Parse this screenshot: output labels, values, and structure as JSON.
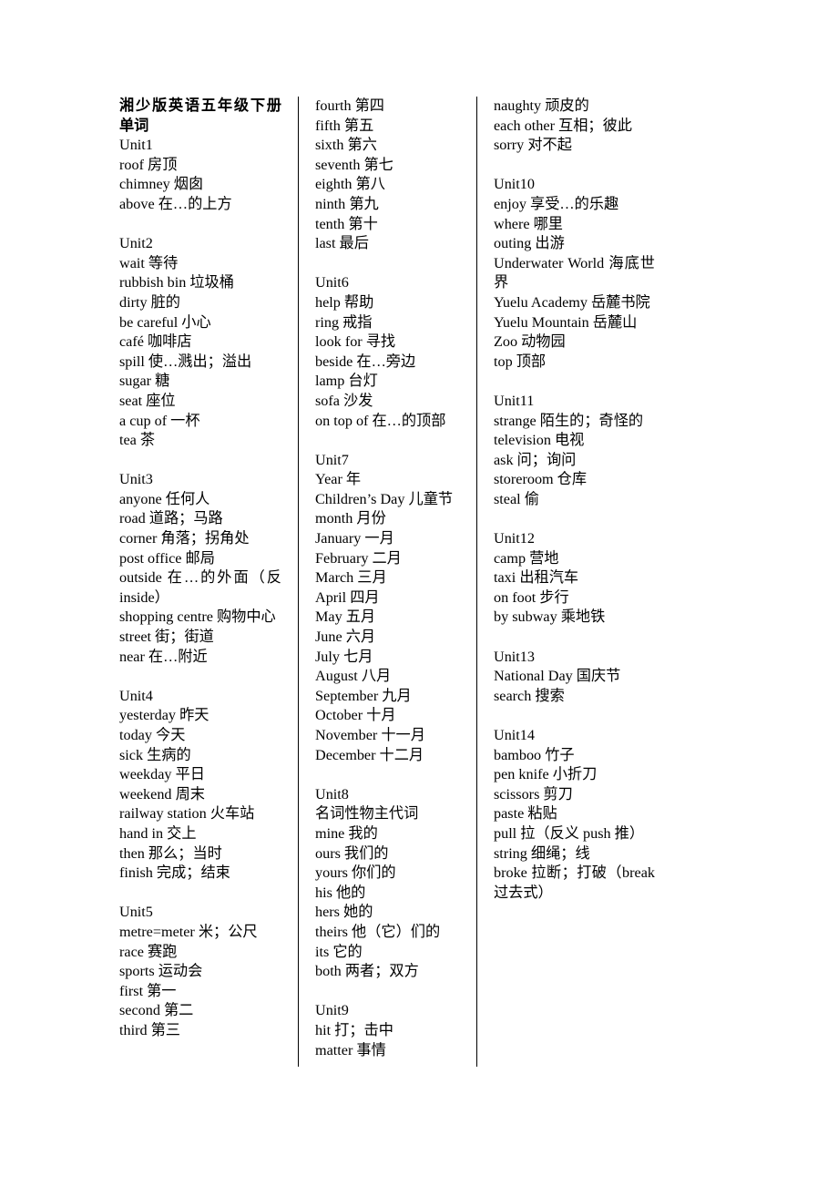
{
  "document": {
    "title": "湘少版英语五年级下册单词",
    "columns": [
      {
        "id": "column-1",
        "blocks": [
          {
            "type": "title",
            "lines": [
              "湘少版英语五年级下册单词"
            ]
          },
          {
            "type": "heading",
            "lines": [
              "Unit1"
            ]
          },
          {
            "type": "entries",
            "lines": [
              "roof 房顶",
              "chimney 烟囱",
              "above 在…的上方"
            ]
          },
          {
            "type": "spacer"
          },
          {
            "type": "heading",
            "lines": [
              "Unit2"
            ]
          },
          {
            "type": "entries",
            "lines": [
              "wait 等待",
              "rubbish bin 垃圾桶",
              "dirty 脏的",
              "be careful  小心",
              "café 咖啡店",
              "spill 使…溅出；溢出",
              "sugar 糖",
              "seat 座位",
              "a cup of 一杯",
              "tea 茶"
            ]
          },
          {
            "type": "spacer"
          },
          {
            "type": "heading",
            "lines": [
              "Unit3"
            ]
          },
          {
            "type": "entries",
            "lines": [
              "anyone 任何人",
              "road 道路；马路",
              "corner 角落；拐角处",
              "post office 邮局",
              "outside 在…的外面（反 inside）",
              "shopping centre 购物中心",
              "street 街；街道",
              "near 在…附近"
            ]
          },
          {
            "type": "spacer"
          },
          {
            "type": "heading",
            "lines": [
              "Unit4"
            ]
          },
          {
            "type": "entries",
            "lines": [
              "yesterday 昨天",
              "today 今天",
              "sick 生病的",
              "weekday 平日",
              "weekend 周末",
              "railway station 火车站",
              "hand in 交上",
              "then 那么；当时",
              "finish 完成；结束"
            ]
          },
          {
            "type": "spacer"
          },
          {
            "type": "heading",
            "lines": [
              "Unit5"
            ]
          },
          {
            "type": "entries",
            "lines": [
              "metre=meter 米；公尺",
              "race 赛跑",
              "sports 运动会",
              "first 第一",
              "second 第二",
              "third 第三"
            ]
          }
        ]
      },
      {
        "id": "column-2",
        "blocks": [
          {
            "type": "entries",
            "lines": [
              "fourth 第四",
              "fifth 第五",
              "sixth 第六",
              "seventh 第七",
              "eighth 第八",
              "ninth 第九",
              "tenth 第十",
              "last 最后"
            ]
          },
          {
            "type": "spacer"
          },
          {
            "type": "heading",
            "lines": [
              "Unit6"
            ]
          },
          {
            "type": "entries",
            "lines": [
              "help 帮助",
              "ring 戒指",
              "look for 寻找",
              "beside 在…旁边",
              "lamp 台灯",
              "sofa 沙发",
              "on top of 在…的顶部"
            ]
          },
          {
            "type": "spacer"
          },
          {
            "type": "heading",
            "lines": [
              "Unit7"
            ]
          },
          {
            "type": "entries",
            "lines": [
              "Year 年",
              "Children’s Day 儿童节",
              "month 月份",
              "January 一月",
              "February 二月",
              "March 三月",
              "April 四月",
              "May 五月",
              "June 六月",
              "July 七月",
              "August 八月",
              "September  九月",
              "October 十月",
              "November 十一月",
              "December 十二月"
            ]
          },
          {
            "type": "spacer"
          },
          {
            "type": "heading",
            "lines": [
              "Unit8"
            ]
          },
          {
            "type": "entries",
            "lines": [
              "名词性物主代词",
              "mine 我的",
              "ours 我们的",
              "yours 你们的",
              "his 他的",
              "hers 她的",
              "theirs 他（它）们的",
              "its  它的",
              "both 两者；双方"
            ]
          },
          {
            "type": "spacer"
          },
          {
            "type": "heading",
            "lines": [
              "Unit9"
            ]
          },
          {
            "type": "entries",
            "lines": [
              "hit 打；击中",
              "matter 事情"
            ]
          }
        ]
      },
      {
        "id": "column-3",
        "blocks": [
          {
            "type": "entries",
            "lines": [
              "naughty 顽皮的",
              "each other 互相；彼此",
              "sorry 对不起"
            ]
          },
          {
            "type": "spacer"
          },
          {
            "type": "heading",
            "lines": [
              "Unit10"
            ]
          },
          {
            "type": "entries",
            "lines": [
              "enjoy 享受…的乐趣",
              "where 哪里",
              "outing 出游",
              "Underwater World 海底世界",
              "Yuelu Academy 岳麓书院",
              "Yuelu Mountain 岳麓山",
              "Zoo 动物园",
              "top 顶部"
            ]
          },
          {
            "type": "spacer"
          },
          {
            "type": "heading",
            "lines": [
              "Unit11"
            ]
          },
          {
            "type": "entries",
            "lines": [
              "strange 陌生的；奇怪的",
              "television 电视",
              "ask 问；询问",
              "storeroom 仓库",
              "steal 偷"
            ]
          },
          {
            "type": "spacer"
          },
          {
            "type": "heading",
            "lines": [
              "Unit12"
            ]
          },
          {
            "type": "entries",
            "lines": [
              "camp 营地",
              "taxi 出租汽车",
              "on foot 步行",
              "by subway 乘地铁"
            ]
          },
          {
            "type": "spacer"
          },
          {
            "type": "heading",
            "lines": [
              "Unit13"
            ]
          },
          {
            "type": "entries",
            "lines": [
              "National Day 国庆节",
              "search 搜索"
            ]
          },
          {
            "type": "spacer"
          },
          {
            "type": "heading",
            "lines": [
              "Unit14"
            ]
          },
          {
            "type": "entries",
            "lines": [
              "bamboo 竹子",
              "pen knife 小折刀",
              "scissors 剪刀",
              "paste 粘贴",
              "pull 拉（反义 push 推）",
              "string 细绳；线",
              "broke 拉断；打破（break 过去式）"
            ]
          }
        ]
      }
    ]
  }
}
